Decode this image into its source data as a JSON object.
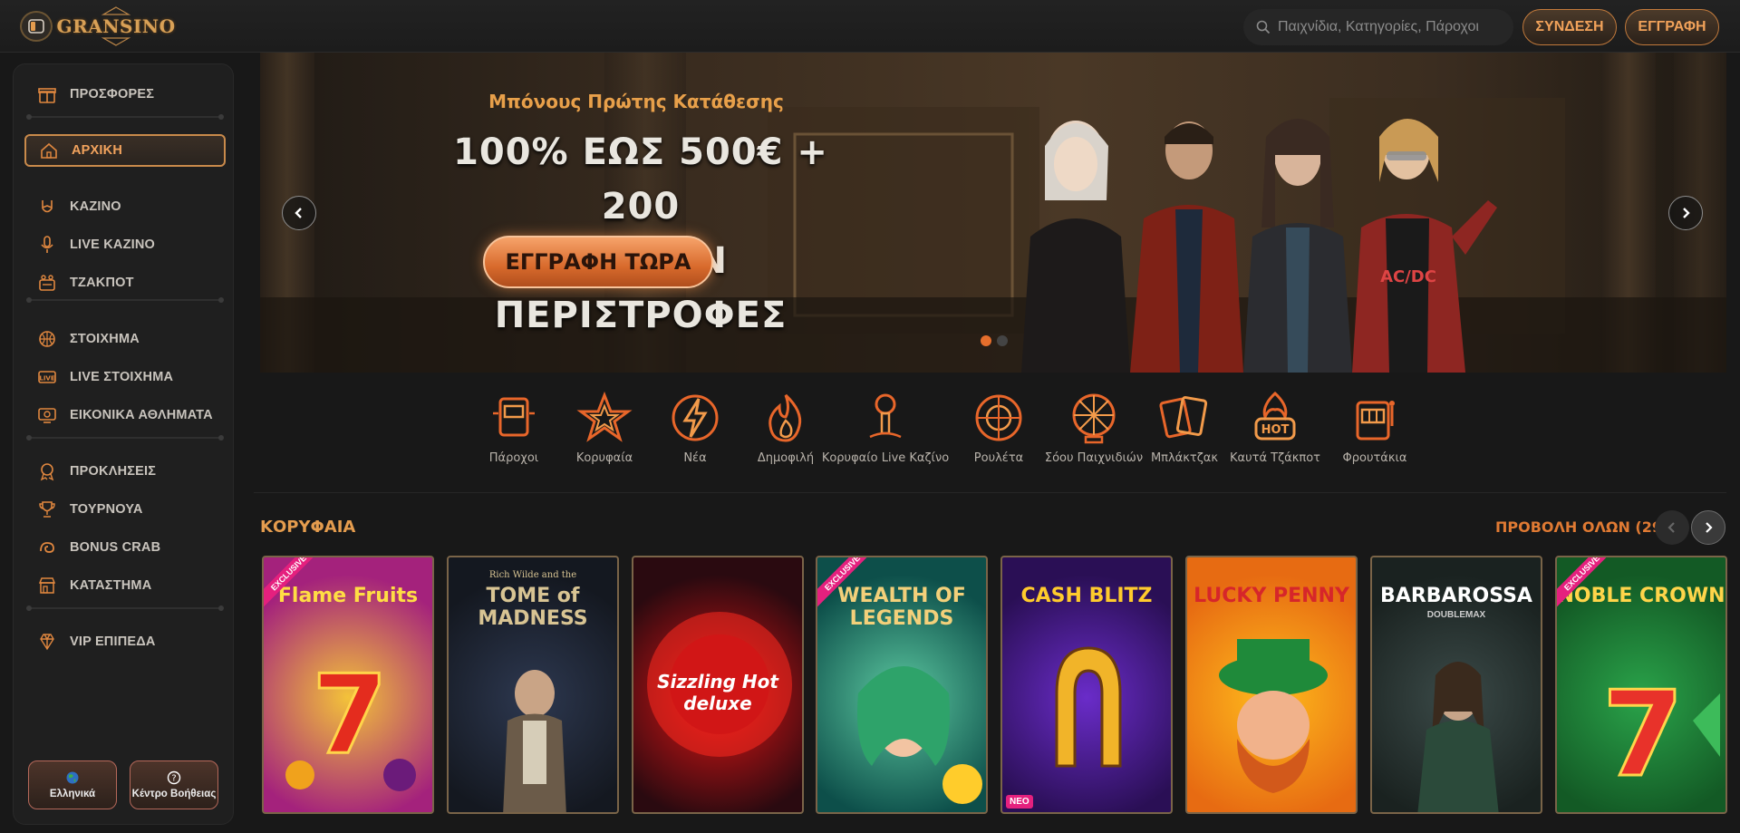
{
  "header": {
    "logo": "GRANSINO",
    "search_placeholder": "Παιχνίδια, Κατηγορίες, Πάροχοι",
    "login": "ΣΥΝΔΕΣΗ",
    "register": "ΕΓΓΡΑΦΗ"
  },
  "sidebar": {
    "items": [
      {
        "label": "ΠΡΟΣΦΟΡΕΣ",
        "icon": "gift-icon"
      },
      {
        "label": "ΑΡΧΙΚΗ",
        "icon": "home-icon"
      },
      {
        "label": "ΚΑΖΙΝΟ",
        "icon": "rock-hand-icon"
      },
      {
        "label": "LIVE ΚΑΖΙΝΟ",
        "icon": "microphone-icon"
      },
      {
        "label": "ΤΖΑΚΠΟΤ",
        "icon": "jackpot-icon"
      },
      {
        "label": "ΣΤΟΙΧΗΜΑ",
        "icon": "basketball-icon"
      },
      {
        "label": "LIVE ΣΤΟΙΧΗΜΑ",
        "icon": "live-icon"
      },
      {
        "label": "ΕΙΚΟΝΙΚΑ ΑΘΛΗΜΑΤΑ",
        "icon": "virtual-monitor-icon"
      },
      {
        "label": "ΠΡΟΚΛΗΣΕΙΣ",
        "icon": "medal-icon"
      },
      {
        "label": "ΤΟΥΡΝΟΥΑ",
        "icon": "trophy-icon"
      },
      {
        "label": "BONUS CRAB",
        "icon": "crab-icon"
      },
      {
        "label": "ΚΑΤΑΣΤΗΜΑ",
        "icon": "store-icon"
      },
      {
        "label": "VIP ΕΠΙΠΕΔΑ",
        "icon": "diamond-icon"
      }
    ],
    "language": "Ελληνικά",
    "help": "Κέντρο Βοήθειας"
  },
  "banner": {
    "subtitle": "Μπόνους Πρώτης Κατάθεσης",
    "title_line1": "100% ΕΩΣ 500€ + 200",
    "title_line2": "ΔΩΡΕΑΝ ΠΕΡΙΣΤΡΟΦΕΣ",
    "cta": "ΕΓΓΡΑΦΗ ΤΩΡΑ",
    "slides": 2,
    "active_slide": 1
  },
  "categories": [
    {
      "label": "Πάροχοι",
      "icon": "provider-machine-icon"
    },
    {
      "label": "Κορυφαία",
      "icon": "star-icon"
    },
    {
      "label": "Νέα",
      "icon": "lightning-icon"
    },
    {
      "label": "Δημοφιλή",
      "icon": "flame-icon"
    },
    {
      "label": "Κορυφαίο Live Καζίνο",
      "icon": "microphone-icon"
    },
    {
      "label": "Ρουλέτα",
      "icon": "roulette-icon"
    },
    {
      "label": "Σόου Παιχνιδιών",
      "icon": "wheel-icon"
    },
    {
      "label": "Μπλάκτζακ",
      "icon": "cards-icon"
    },
    {
      "label": "Καυτά Τζάκποτ",
      "icon": "hot-icon"
    },
    {
      "label": "Φρουτάκια",
      "icon": "slot-machine-icon"
    }
  ],
  "games_section": {
    "title": "ΚΟΡΥΦΑΙΑ",
    "view_all": "ΠΡΟΒΟΛΗ ΟΛΩΝ (292)",
    "games": [
      {
        "name": "Flame Fruits",
        "badge": "EXCLUSIVE",
        "bg1": "#f3c23a",
        "bg2": "#a4227c",
        "color": "#ffdd44"
      },
      {
        "name": "TOME of MADNESS",
        "subtitle": "Rich Wilde and the",
        "badge": "",
        "bg1": "#2d3850",
        "bg2": "#141820",
        "color": "#d8c493"
      },
      {
        "name": "Sizzling Hot deluxe",
        "badge": "",
        "bg1": "#e51515",
        "bg2": "#2a0a10",
        "color": "#ffffff"
      },
      {
        "name": "WEALTH OF LEGENDS",
        "badge": "EXCLUSIVE",
        "bg1": "#5cc8a0",
        "bg2": "#0d4f4a",
        "color": "#f3d07a"
      },
      {
        "name": "CASH BLITZ",
        "badge": "",
        "bg1": "#6a2cc9",
        "bg2": "#2a0f55",
        "color": "#ffcb2c",
        "tag": "ΝΕΟ"
      },
      {
        "name": "LUCKY PENNY",
        "badge": "",
        "bg1": "#ffbb1c",
        "bg2": "#e76b12",
        "color": "#d6262a"
      },
      {
        "name": "BARBAROSSA",
        "subtitle": "DOUBLEMAX",
        "badge": "",
        "bg1": "#3b4a48",
        "bg2": "#1a2220",
        "color": "#ffffff"
      },
      {
        "name": "NOBLE CROWN",
        "badge": "EXCLUSIVE",
        "bg1": "#2aa34a",
        "bg2": "#135a25",
        "color": "#ffd54a"
      }
    ]
  },
  "colors": {
    "accent": "#e49c4e",
    "cta": "#d86a2c",
    "badge": "#e5207e"
  }
}
